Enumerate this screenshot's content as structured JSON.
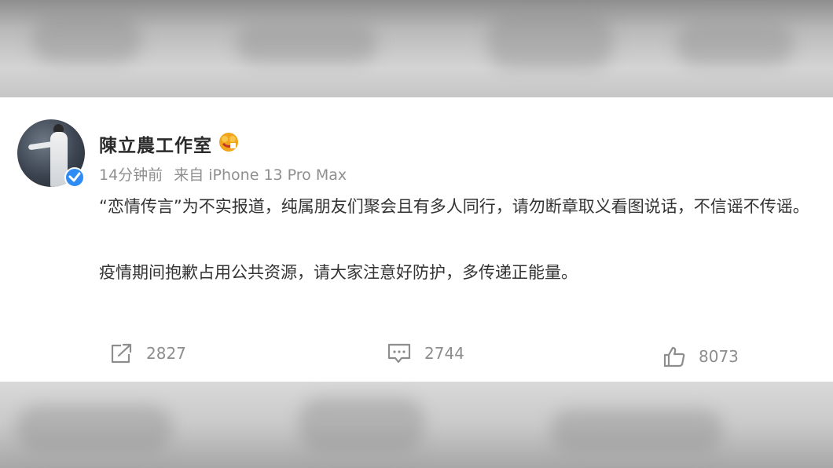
{
  "account": {
    "name": "陳立農工作室",
    "time": "14分钟前",
    "source": "来自 iPhone 13 Pro Max"
  },
  "post": {
    "paragraphs": [
      "“恋情传言”为不实报道，纯属朋友们聚会且有多人同行，请勿断章取义看图说话，不信谣不传谣。",
      "疫情期间抱歉占用公共资源，请大家注意好防护，多传递正能量。"
    ]
  },
  "actions": {
    "reposts": "2827",
    "comments": "2744",
    "likes": "8073"
  },
  "icons": {
    "avatar": "avatar-photo",
    "verified": "verified-badge-icon",
    "badge": "vip-badge-icon",
    "share": "share-icon",
    "comment": "comment-icon",
    "like": "thumbs-up-icon"
  },
  "colors": {
    "verified": "#2f8cf5",
    "badge": "#f2a51b",
    "meta_text": "#8f8f8f",
    "body_text": "#333333"
  }
}
